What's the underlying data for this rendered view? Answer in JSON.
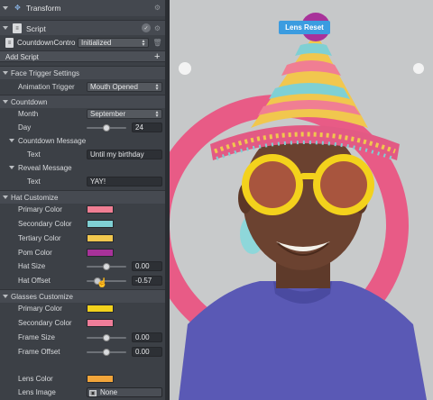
{
  "panel": {
    "transform_title": "Transform",
    "script_title": "Script",
    "script_name": "CountdownContro",
    "script_state": "Initialized",
    "add_script": "Add Script",
    "add_plus": "+",
    "sections": {
      "face_trigger": "Face Trigger Settings",
      "animation_trigger_label": "Animation Trigger",
      "animation_trigger_value": "Mouth Opened",
      "countdown": "Countdown",
      "month_label": "Month",
      "month_value": "September",
      "day_label": "Day",
      "day_value": "24",
      "day_fraction": 0.5,
      "countdown_message": "Countdown Message",
      "text_label": "Text",
      "countdown_text": "Until my birthday",
      "reveal_message": "Reveal Message",
      "reveal_text_label": "Text",
      "reveal_text": "YAY!",
      "hat_customize": "Hat Customize",
      "primary_color_label": "Primary Color",
      "secondary_color_label": "Secondary Color",
      "tertiary_color_label": "Tertiary Color",
      "pom_color_label": "Pom Color",
      "hat_size_label": "Hat Size",
      "hat_size_value": "0.00",
      "hat_offset_label": "Hat Offset",
      "hat_offset_value": "-0.57",
      "glasses_customize": "Glasses Customize",
      "g_primary_label": "Primary Color",
      "g_secondary_label": "Secondary Color",
      "frame_size_label": "Frame Size",
      "frame_size_value": "0.00",
      "frame_offset_label": "Frame Offset",
      "frame_offset_value": "0.00",
      "lens_color_label": "Lens Color",
      "lens_image_label": "Lens Image",
      "lens_image_value": "None"
    }
  },
  "colors": {
    "hat_primary": "#f07e93",
    "hat_secondary": "#7fd0d4",
    "hat_tertiary": "#f1c74e",
    "pom": "#a8329a",
    "glasses_primary": "#f3d21c",
    "glasses_secondary": "#ef7d99",
    "lens": "#f2a53a"
  },
  "preview": {
    "lens_reset": "Lens Reset"
  }
}
